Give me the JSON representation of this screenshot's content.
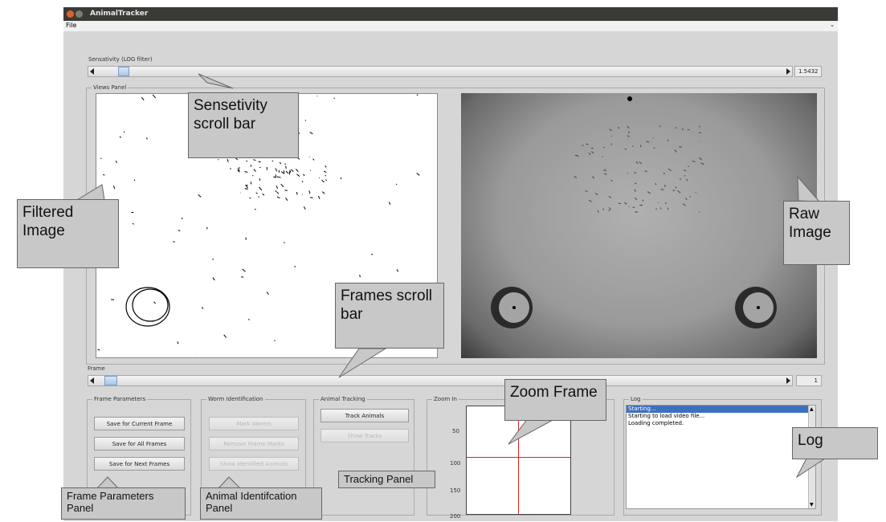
{
  "window": {
    "title": "AnimalTracker",
    "menu_file": "File"
  },
  "sensitivity": {
    "label": "Sensativity (LOG filter)",
    "value": "1.5432",
    "position": 0.03
  },
  "views_panel": {
    "title": "Views Panel"
  },
  "frame": {
    "label": "Frame",
    "value": "1",
    "position": 0.01
  },
  "frame_parameters": {
    "title": "Frame Parameters",
    "buttons": [
      "Save for Current Frame",
      "Save for All Frames",
      "Save for Next Frames"
    ]
  },
  "worm_identification": {
    "title": "Worm Identification",
    "buttons": [
      "Mark Worms",
      "Remove Frame Marks",
      "Show Identified Animals"
    ]
  },
  "animal_tracking": {
    "title": "Animal Tracking",
    "buttons": [
      "Track Animals",
      "Show Tracks"
    ]
  },
  "zoom": {
    "title": "Zoom In",
    "ticks": [
      "50",
      "100",
      "150",
      "200"
    ]
  },
  "log": {
    "title": "Log",
    "lines": [
      "Starting...",
      "Starting to load video file...",
      "Loading completed."
    ]
  },
  "annotations": {
    "sensitivity": "Sensetivity scroll bar",
    "filtered": "Filtered Image",
    "raw": "Raw Image",
    "frames": "Frames scroll bar",
    "zoom": "Zoom Frame",
    "log": "Log",
    "tracking": "Tracking Panel",
    "frame_params": "Frame Parameters Panel",
    "animal_ident": "Animal Identifcation Panel"
  },
  "colors": {
    "titlebar": "#3b3a37",
    "log_selection": "#3d6fbf",
    "crosshair": "#e02020",
    "close_button": "#e0602c"
  }
}
